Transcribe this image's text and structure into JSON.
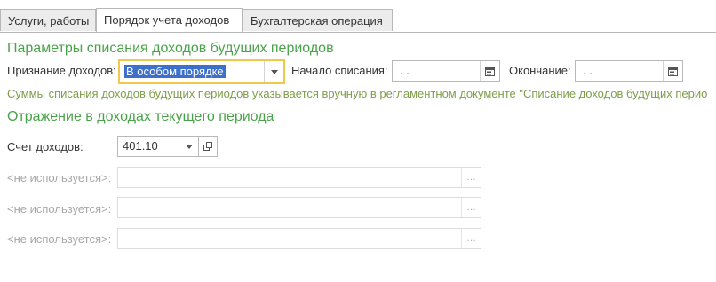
{
  "tabs": [
    {
      "label": "Услуги, работы",
      "active": false
    },
    {
      "label": "Порядок учета доходов",
      "active": true
    },
    {
      "label": "Бухгалтерская операция",
      "active": false
    }
  ],
  "future_income": {
    "title": "Параметры списания доходов будущих периодов",
    "recognition_label": "Признание доходов:",
    "recognition_value": "В особом порядке",
    "start_label": "Начало списания:",
    "start_value": " .  .",
    "end_label": "Окончание:",
    "end_value": " .  .",
    "hint": "Суммы списания доходов будущих периодов указывается вручную в регламентном документе \"Списание доходов будущих перио"
  },
  "current_income": {
    "title": "Отражение в доходах текущего периода",
    "account_label": "Счет доходов:",
    "account_value": "401.10",
    "unused_rows": [
      {
        "label": "<не используется>:",
        "value": ""
      },
      {
        "label": "<не используется>:",
        "value": ""
      },
      {
        "label": "<не используется>:",
        "value": ""
      }
    ]
  },
  "icons": {
    "dropdown": "chevron-down-icon",
    "calendar": "calendar-icon",
    "open": "open-icon",
    "ellipsis": "ellipsis-icon"
  },
  "colors": {
    "section_title": "#4aa34a",
    "hint": "#7e9e4a",
    "focus_border": "#f2c84b",
    "selection": "#3d6fcc"
  }
}
